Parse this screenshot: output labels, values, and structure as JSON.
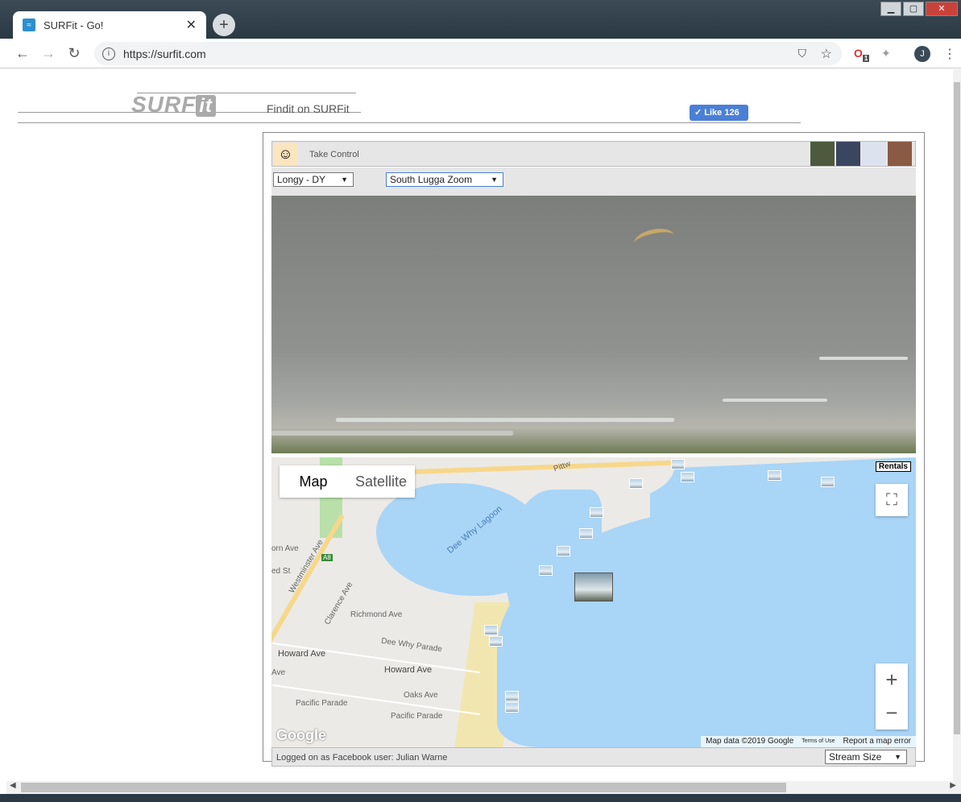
{
  "browser": {
    "tab_title": "SURFit - Go!",
    "tab_close": "✕",
    "new_tab": "+",
    "url": "https://surfit.com",
    "avatar_letter": "J",
    "ext_badge": "1"
  },
  "header": {
    "logo_text": "SURF",
    "logo_it": "it",
    "tagline": "Findit on SURFit",
    "like_label": "Like 126"
  },
  "widget": {
    "take_control": "Take Control",
    "camera_select": "Longy - DY",
    "zoom_select": "South Lugga Zoom",
    "footer_text": "Logged on as Facebook user: Julian Warne",
    "stream_size": "Stream Size"
  },
  "map": {
    "tab_map": "Map",
    "tab_satellite": "Satellite",
    "rentals": "Rentals",
    "zoom_in": "+",
    "zoom_out": "−",
    "google": "Google",
    "attrib_data": "Map data ©2019 Google",
    "attrib_terms": "Terms of Use",
    "attrib_report": "Report a map error",
    "lagoon_label": "Dee Why Lagoon",
    "roads": [
      "Howard Ave",
      "Howard Ave",
      "Richmond Ave",
      "Dee Why Parade",
      "Oaks Ave",
      "Pacific Parade",
      "Pacific Parade",
      "Westminster Ave",
      "Clarence Ave",
      "A8",
      "Pittw",
      "orn Ave",
      "ed St",
      "Ave"
    ]
  }
}
